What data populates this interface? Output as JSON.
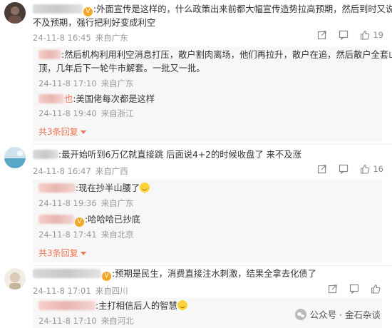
{
  "comments": [
    {
      "name_tail": "",
      "text_line1": ":外面宣传是这样的，什么政策出来前都大幅宣传造势拉高预期，然后到时又说",
      "text_line2": "不及预期，强行把利好变成利空",
      "date": "24-11-8 16:45",
      "location": "来自广东",
      "like_count": "19",
      "replies": [
        {
          "name_tail": "",
          "text_line1": ":然后机构利用利空消息打压，散户割肉离场，他们再拉升，散户在追，然后散户全套山",
          "text_line2": "顶，几年后下一轮牛市解套。一批又一批。",
          "date": "24-11-8 17:10",
          "location": "来自广东"
        },
        {
          "name_tail": "也",
          "text_line1": ":美国佬每次都是这样",
          "date": "24-11-8 19:40",
          "location": "来自浙江"
        }
      ],
      "more_label": "共3条回复"
    },
    {
      "name_tail": "",
      "text_line1": ":最开始听到6万亿就直接跳 后面说4+2的时候收盘了 来不及涨",
      "date": "24-11-8 16:47",
      "location": "来自广西",
      "like_count": "16",
      "replies": [
        {
          "name_tail": "",
          "text_line1": ":现在抄半山腰了",
          "date": "24-11-8 19:36",
          "location": "来自广东"
        },
        {
          "name_tail": "",
          "text_line1": ":哈哈哈已抄底",
          "date": "24-11-8 17:41",
          "location": "来自北京"
        }
      ],
      "more_label": "共3条回复"
    },
    {
      "name_tail": "",
      "text_line1": ":预期是民生，消费直接注水刺激，结果全拿去化债了",
      "date": "24-11-8 17:01",
      "location": "来自四川",
      "like_count": "",
      "replies": [
        {
          "name_tail": "",
          "text_line1": ":主打相信后人的智慧",
          "date": "24-11-8 17:10",
          "location": "来自河北"
        }
      ]
    }
  ],
  "watermark": {
    "label": "公众号 · 金石杂谈"
  },
  "colors": {
    "accent": "#eb7350",
    "meta": "#999999",
    "reply_bg": "#f7f7f7"
  }
}
